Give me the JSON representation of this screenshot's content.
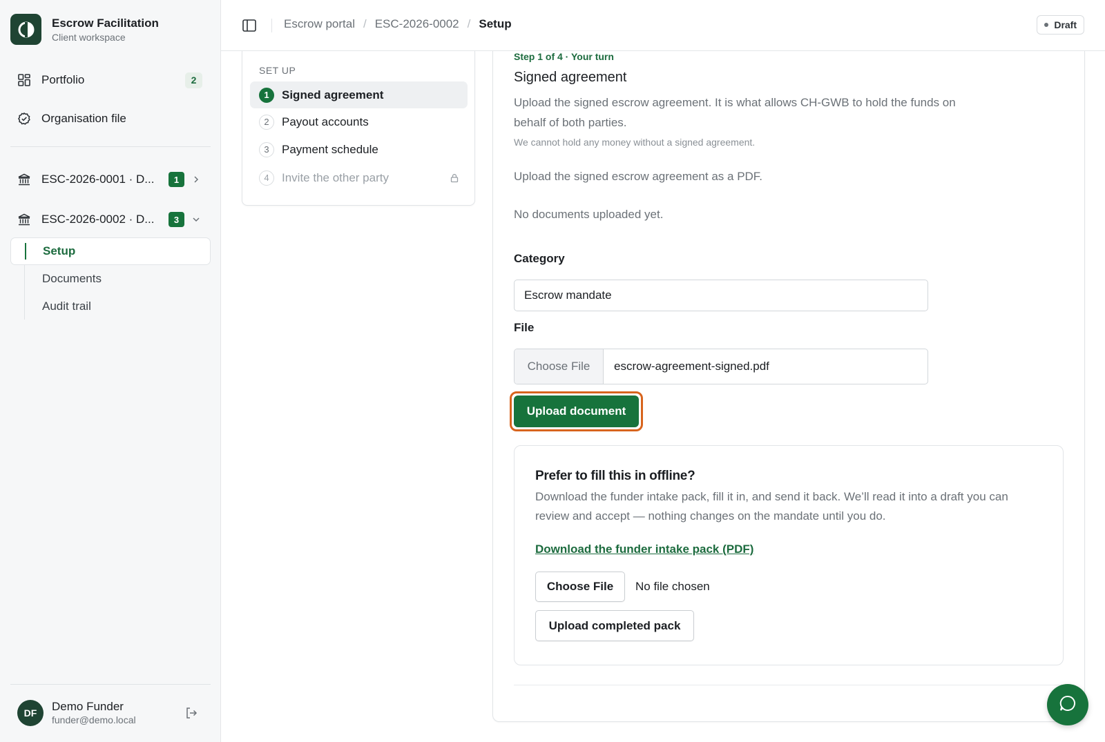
{
  "brand": {
    "title": "Escrow Facilitation",
    "subtitle": "Client workspace",
    "logo_icon": "app-logo-icon"
  },
  "sidebar": {
    "items": [
      {
        "label": "Portfolio",
        "icon": "grid-icon",
        "badge": "2"
      },
      {
        "label": "Organisation file",
        "icon": "check-circle-icon"
      }
    ],
    "cases": [
      {
        "label": "ESC-2026-0001 · D...",
        "badge": "1",
        "expanded": false,
        "icon": "bank-icon"
      },
      {
        "label": "ESC-2026-0002 · D...",
        "badge": "3",
        "expanded": true,
        "icon": "bank-icon"
      }
    ],
    "sub_items": [
      {
        "label": "Setup",
        "active": true
      },
      {
        "label": "Documents",
        "active": false
      },
      {
        "label": "Audit trail",
        "active": false
      }
    ],
    "user": {
      "initials": "DF",
      "name": "Demo Funder",
      "email": "funder@demo.local"
    }
  },
  "topbar": {
    "breadcrumbs": [
      "Escrow portal",
      "ESC-2026-0002",
      "Setup"
    ],
    "status": "Draft"
  },
  "steps": {
    "heading": "SET UP",
    "items": [
      {
        "num": "1",
        "label": "Signed agreement",
        "active": true,
        "locked": false
      },
      {
        "num": "2",
        "label": "Payout accounts",
        "active": false,
        "locked": false
      },
      {
        "num": "3",
        "label": "Payment schedule",
        "active": false,
        "locked": false
      },
      {
        "num": "4",
        "label": "Invite the other party",
        "active": false,
        "locked": true
      }
    ]
  },
  "main": {
    "kicker": "Step 1 of 4 · Your turn",
    "title": "Signed agreement",
    "intro": "Upload the signed escrow agreement. It is what allows CH-GWB to hold the funds on behalf of both parties.",
    "hint": "We cannot hold any money without a signed agreement.",
    "instruction": "Upload the signed escrow agreement as a PDF.",
    "empty_state": "No documents uploaded yet.",
    "category_label": "Category",
    "category_value": "Escrow mandate",
    "file_label": "File",
    "file_button": "Choose File",
    "file_name": "escrow-agreement-signed.pdf",
    "upload_button": "Upload document"
  },
  "offline": {
    "title": "Prefer to fill this in offline?",
    "text": "Download the funder intake pack, fill it in, and send it back. We’ll read it into a draft you can review and accept — nothing changes on the mandate until you do.",
    "link": "Download the funder intake pack (PDF)",
    "choose_button": "Choose File",
    "no_file": "No file chosen",
    "upload_button": "Upload completed pack"
  },
  "colors": {
    "accent": "#17733c",
    "brand_dark": "#1f4433",
    "focus_ring": "#d8641d"
  }
}
